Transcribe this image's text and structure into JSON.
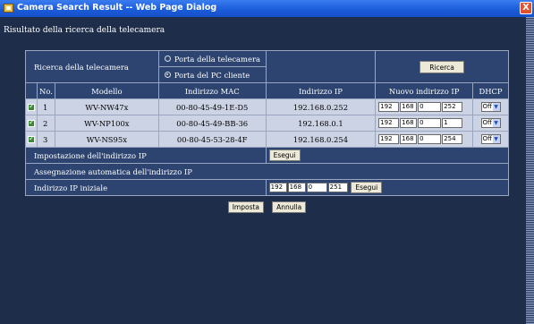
{
  "window": {
    "title": "Camera Search Result -- Web Page Dialog",
    "close_label": "X"
  },
  "subheader": "Risultato della ricerca della telecamera",
  "search": {
    "label": "Ricerca della telecamera",
    "radio_camera_port": "Porta della telecamera",
    "radio_client_port": "Porta del PC cliente",
    "search_button": "Ricerca"
  },
  "table": {
    "headers": {
      "no": "No.",
      "model": "Modello",
      "mac": "Indirizzo MAC",
      "ip": "Indirizzo IP",
      "new_ip": "Nuovo indirizzo IP",
      "dhcp": "DHCP"
    },
    "rows": [
      {
        "checked": true,
        "no": "1",
        "model": "WV-NW47x",
        "mac": "00-80-45-49-1E-D5",
        "ip": "192.168.0.252",
        "new_ip": [
          "192",
          "168",
          "0",
          "252"
        ],
        "dhcp": "Off"
      },
      {
        "checked": true,
        "no": "2",
        "model": "WV-NP100x",
        "mac": "00-80-45-49-BB-36",
        "ip": "192.168.0.1",
        "new_ip": [
          "192",
          "168",
          "0",
          "1"
        ],
        "dhcp": "Off"
      },
      {
        "checked": true,
        "no": "3",
        "model": "WV-NS95x",
        "mac": "00-80-45-53-28-4F",
        "ip": "192.168.0.254",
        "new_ip": [
          "192",
          "168",
          "0",
          "254"
        ],
        "dhcp": "Off"
      }
    ]
  },
  "ip_setting": {
    "label": "Impostazione dell'indirizzo IP",
    "execute_button": "Esegui"
  },
  "auto_assign": {
    "label": "Assegnazione automatica dell'indirizzo IP"
  },
  "initial_ip": {
    "label": "Indirizzo IP iniziale",
    "octets": [
      "192",
      "168",
      "0",
      "251"
    ],
    "execute_button": "Esegui"
  },
  "buttons": {
    "set": "Imposta",
    "cancel": "Annulla"
  }
}
